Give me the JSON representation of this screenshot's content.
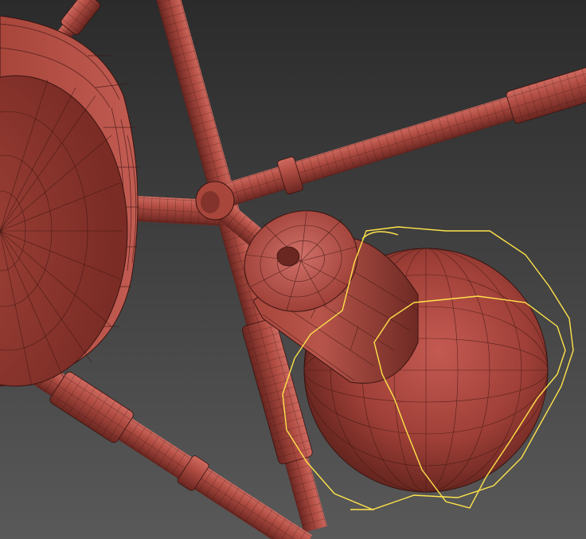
{
  "viewport": {
    "background_top": "#2b2b2b",
    "background_bottom": "#575757"
  },
  "mesh": {
    "base_color": "#a8463c",
    "light_color": "#c8625a",
    "dark_color": "#5a1f1a",
    "wire_color": "#3a1410",
    "selection_color": "#ffe34a"
  }
}
